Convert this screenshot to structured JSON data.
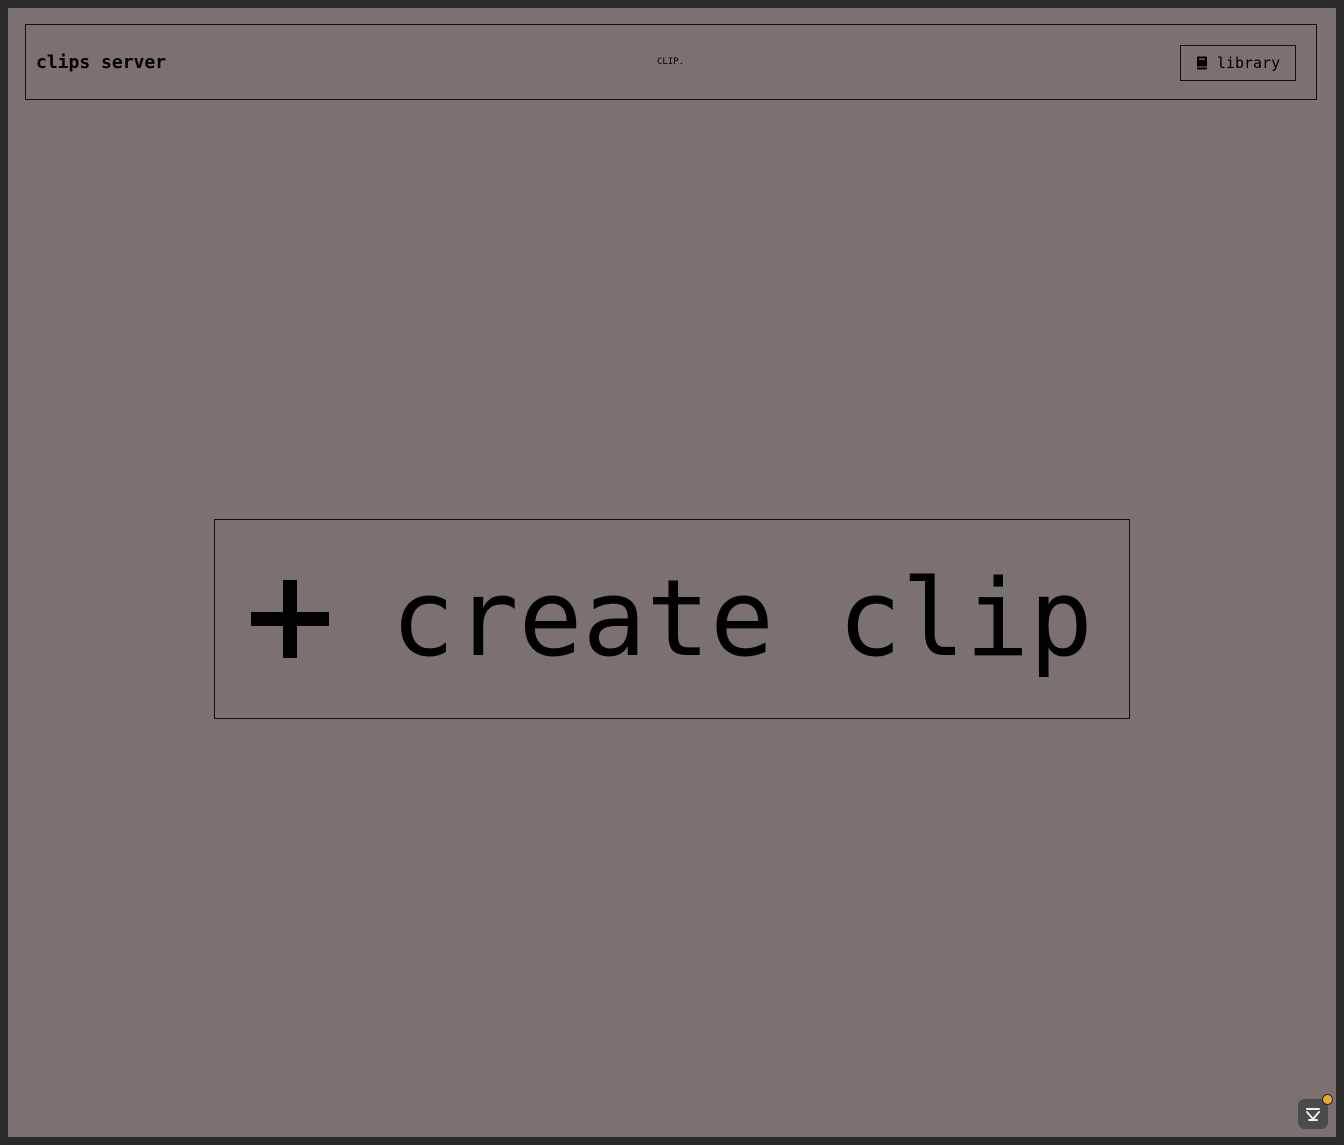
{
  "header": {
    "site_title": "clips server",
    "brand_mark": "CLIP.",
    "library_button": {
      "icon": "book-icon",
      "label": "library"
    }
  },
  "main": {
    "create_clip_button": {
      "icon": "plus-icon",
      "label": "create clip"
    }
  },
  "assistant_badge": {
    "icon": "assistant-icon",
    "notification_color": "#f3a530"
  },
  "colors": {
    "page_background": "#7b7170",
    "window_frame": "#2b2b2b",
    "text": "#000000",
    "border": "#111111"
  }
}
